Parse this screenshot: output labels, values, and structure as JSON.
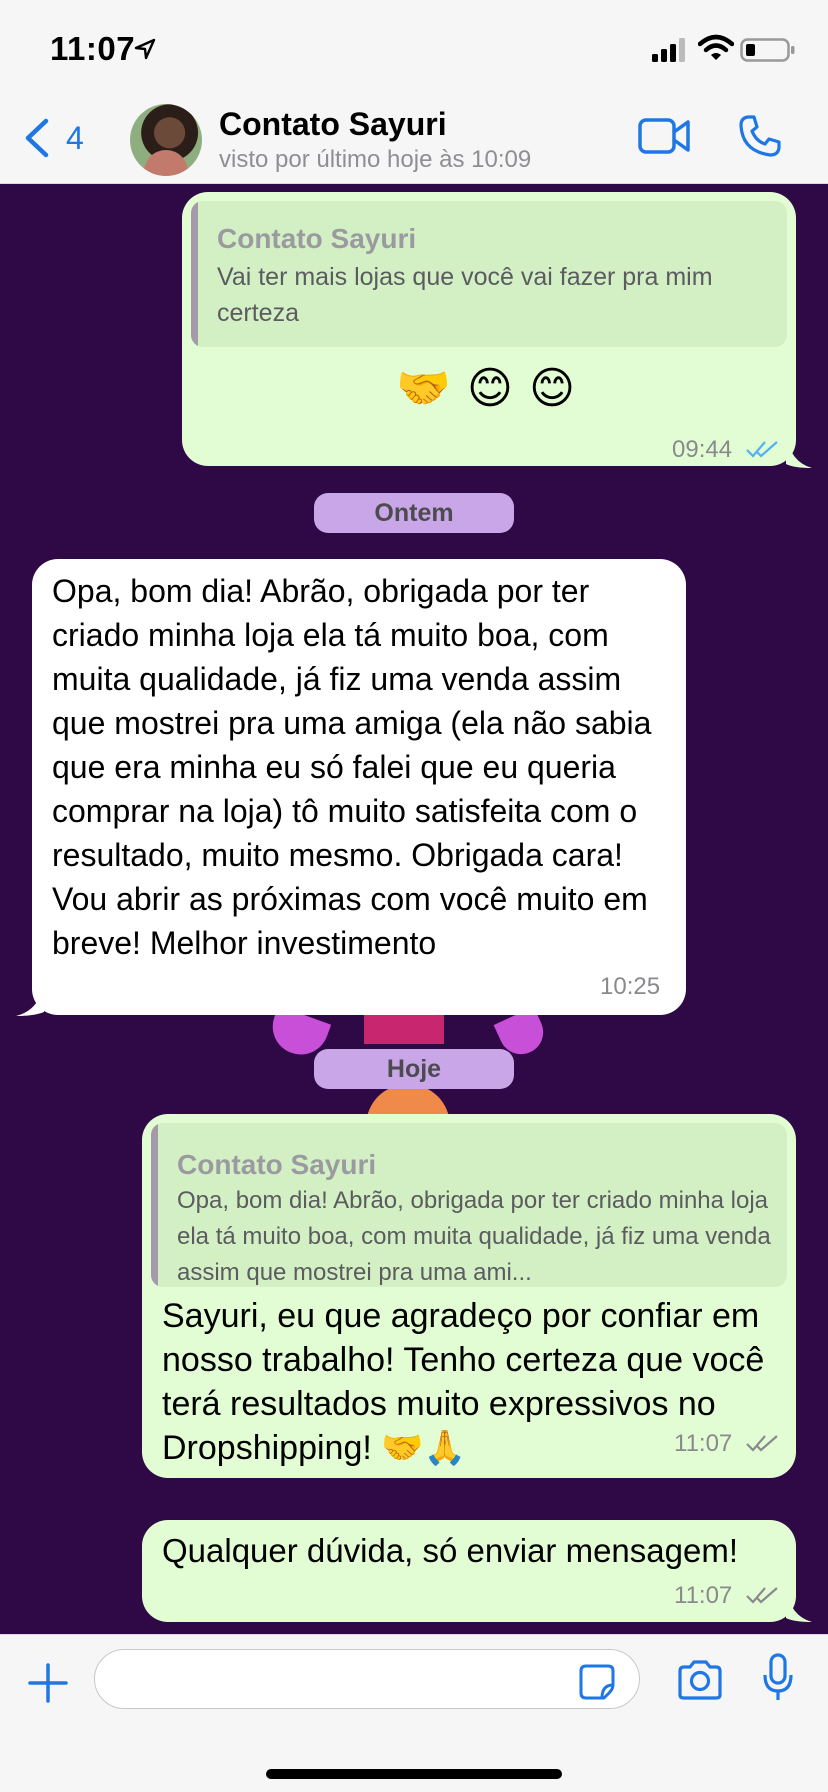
{
  "status_bar": {
    "time": "11:07"
  },
  "header": {
    "back_count": "4",
    "contact_name": "Contato Sayuri",
    "last_seen": "visto por último hoje às 10:09"
  },
  "messages": {
    "m1": {
      "quote_name": "Contato Sayuri",
      "quote_text": "Vai ter mais lojas que você vai fazer pra mim certeza",
      "text": "🤝 😊 😊",
      "time": "09:44",
      "status": "read"
    },
    "date_yesterday": "Ontem",
    "m2": {
      "text": "Opa, bom dia! Abrão, obrigada por ter criado minha loja ela tá muito boa, com muita qualidade, já fiz uma venda assim que mostrei pra uma amiga (ela não sabia que era minha eu só falei que eu queria comprar na loja) tô muito satisfeita com o resultado, muito mesmo. Obrigada cara! Vou abrir as próximas com você muito em breve! Melhor investimento",
      "time": "10:25"
    },
    "date_today": "Hoje",
    "m3": {
      "quote_name": "Contato Sayuri",
      "quote_text": "Opa, bom dia! Abrão, obrigada por ter criado minha loja ela tá muito boa, com muita qualidade, já fiz uma venda assim que mostrei pra uma ami...",
      "text": "Sayuri, eu que agradeço por confiar em nosso trabalho! Tenho certeza que você terá resultados muito expressivos no Dropshipping! 🤝🙏",
      "time": "11:07",
      "status": "delivered"
    },
    "m4": {
      "text": "Qualquer dúvida, só enviar mensagem!",
      "time": "11:07",
      "status": "delivered"
    }
  },
  "input_bar": {
    "value": "",
    "placeholder": ""
  },
  "colors": {
    "chat_background": "#2f0846",
    "outgoing_bubble": "#e2fdd3",
    "incoming_bubble": "#ffffff",
    "accent_blue": "#1e77e4",
    "date_pill": "#c8a6e8",
    "read_ticks": "#4fb2f2"
  },
  "icons": [
    "location-arrow-icon",
    "signal-icon",
    "wifi-icon",
    "battery-icon",
    "back-chevron-icon",
    "video-call-icon",
    "phone-call-icon",
    "plus-icon",
    "sticker-icon",
    "camera-icon",
    "microphone-icon"
  ]
}
